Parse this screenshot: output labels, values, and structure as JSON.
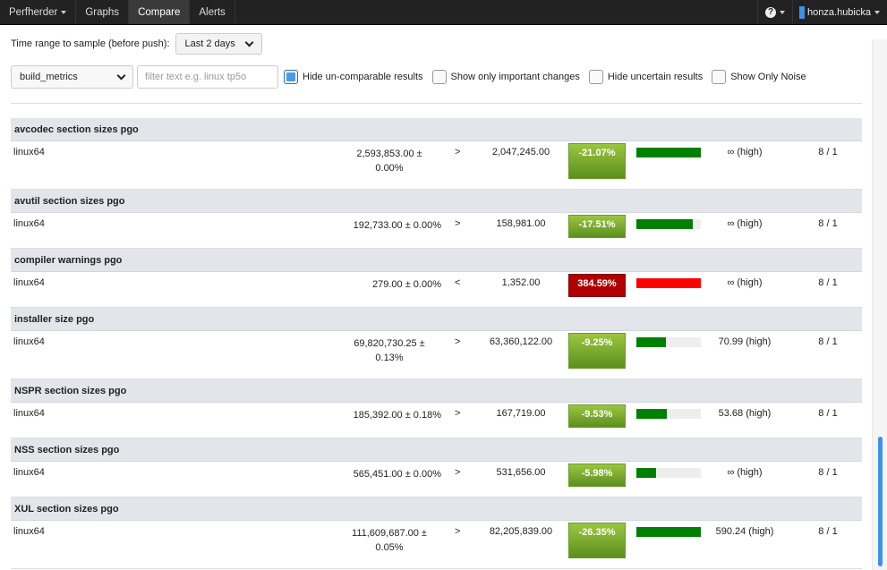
{
  "navbar": {
    "brand": "Perfherder",
    "items": [
      "Graphs",
      "Compare",
      "Alerts"
    ],
    "help_glyph": "?",
    "user": "honza.hubicka"
  },
  "controls": {
    "time_range_label": "Time range to sample (before push):",
    "time_range_value": "Last 2 days",
    "framework_value": "build_metrics",
    "filter_placeholder": "filter text e.g. linux tp5o",
    "checkboxes": [
      {
        "label": "Hide un-comparable results",
        "checked": true
      },
      {
        "label": "Show only important changes",
        "checked": false
      },
      {
        "label": "Hide uncertain results",
        "checked": false
      },
      {
        "label": "Show Only Noise",
        "checked": false
      }
    ]
  },
  "results": [
    {
      "title": "avcodec section sizes pgo",
      "platform": "linux64",
      "base": "2,593,853.00 ± 0.00%",
      "base_wrap": true,
      "cmp": ">",
      "new": "2,047,245.00",
      "delta": "-21.07%",
      "status": "good",
      "magnitude": 1.0,
      "confidence": "∞ (high)",
      "runs": "8 / 1"
    },
    {
      "title": "avutil section sizes pgo",
      "platform": "linux64",
      "base": "192,733.00 ± 0.00%",
      "base_wrap": false,
      "cmp": ">",
      "new": "158,981.00",
      "delta": "-17.51%",
      "status": "good",
      "magnitude": 0.88,
      "confidence": "∞ (high)",
      "runs": "8 / 1"
    },
    {
      "title": "compiler warnings pgo",
      "platform": "linux64",
      "base": "279.00 ± 0.00%",
      "base_wrap": false,
      "cmp": "<",
      "new": "1,352.00",
      "delta": "384.59%",
      "status": "bad",
      "magnitude": 1.0,
      "confidence": "∞ (high)",
      "runs": "8 / 1"
    },
    {
      "title": "installer size pgo",
      "platform": "linux64",
      "base": "69,820,730.25 ± 0.13%",
      "base_wrap": true,
      "cmp": ">",
      "new": "63,360,122.00",
      "delta": "-9.25%",
      "status": "good",
      "magnitude": 0.46,
      "confidence": "70.99 (high)",
      "runs": "8 / 1"
    },
    {
      "title": "NSPR section sizes pgo",
      "platform": "linux64",
      "base": "185,392.00 ± 0.18%",
      "base_wrap": false,
      "cmp": ">",
      "new": "167,719.00",
      "delta": "-9.53%",
      "status": "good",
      "magnitude": 0.47,
      "confidence": "53.68 (high)",
      "runs": "8 / 1"
    },
    {
      "title": "NSS section sizes pgo",
      "platform": "linux64",
      "base": "565,451.00 ± 0.00%",
      "base_wrap": false,
      "cmp": ">",
      "new": "531,656.00",
      "delta": "-5.98%",
      "status": "good",
      "magnitude": 0.3,
      "confidence": "∞ (high)",
      "runs": "8 / 1"
    },
    {
      "title": "XUL section sizes pgo",
      "platform": "linux64",
      "base": "111,609,687.00 ± 0.05%",
      "base_wrap": true,
      "cmp": ">",
      "new": "82,205,839.00",
      "delta": "-26.35%",
      "status": "good",
      "magnitude": 1.0,
      "confidence": "590.24 (high)",
      "runs": "8 / 1"
    }
  ],
  "colors": {
    "good_bar": "#008000",
    "bad_bar": "#ff0000",
    "scroll_thumb": "#3d8ff0"
  }
}
